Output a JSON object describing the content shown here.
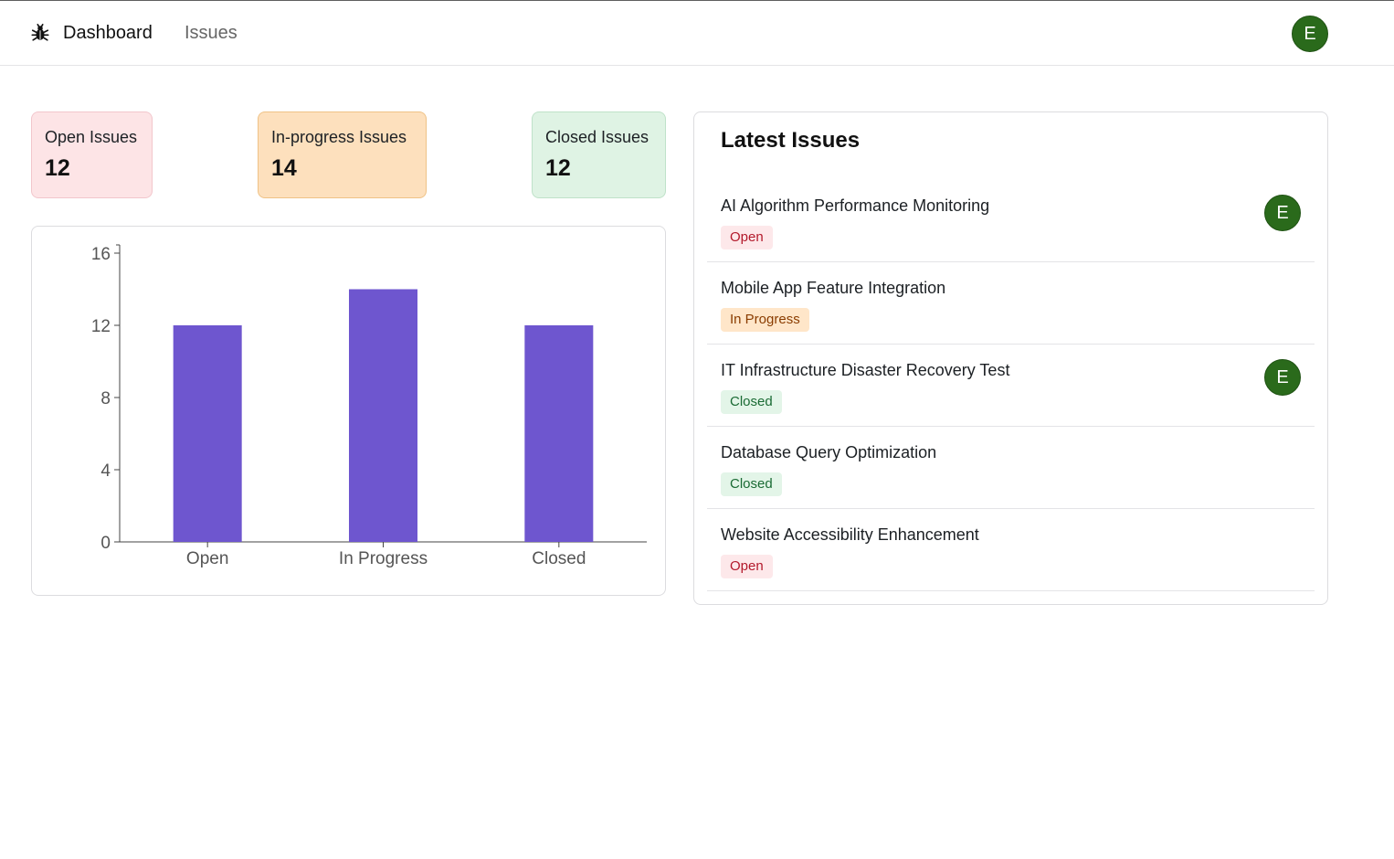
{
  "nav": {
    "logo_icon": "bug-icon",
    "dashboard_label": "Dashboard",
    "issues_label": "Issues",
    "avatar_initial": "E"
  },
  "summary": {
    "open": {
      "label": "Open Issues",
      "value": "12"
    },
    "in_progress": {
      "label": "In-progress Issues",
      "value": "14"
    },
    "closed": {
      "label": "Closed Issues",
      "value": "12"
    }
  },
  "chart_data": {
    "type": "bar",
    "categories": [
      "Open",
      "In Progress",
      "Closed"
    ],
    "values": [
      12,
      14,
      12
    ],
    "ylim": [
      0,
      16
    ],
    "yticks": [
      0,
      4,
      8,
      12,
      16
    ],
    "bar_color": "#6e56cf",
    "title": "",
    "xlabel": "",
    "ylabel": "",
    "grid": false
  },
  "latest": {
    "title": "Latest Issues",
    "items": [
      {
        "title": "AI Algorithm Performance Monitoring",
        "status": "Open",
        "status_key": "open",
        "assignee": "E"
      },
      {
        "title": "Mobile App Feature Integration",
        "status": "In Progress",
        "status_key": "progress",
        "assignee": ""
      },
      {
        "title": "IT Infrastructure Disaster Recovery Test",
        "status": "Closed",
        "status_key": "closed",
        "assignee": "E"
      },
      {
        "title": "Database Query Optimization",
        "status": "Closed",
        "status_key": "closed",
        "assignee": ""
      },
      {
        "title": "Website Accessibility Enhancement",
        "status": "Open",
        "status_key": "open",
        "assignee": ""
      }
    ]
  },
  "colors": {
    "avatar_bg": "#2a6a1b",
    "open_card_bg": "#fde4e6",
    "progress_card_bg": "#fde0bd",
    "closed_card_bg": "#dff3e4"
  }
}
